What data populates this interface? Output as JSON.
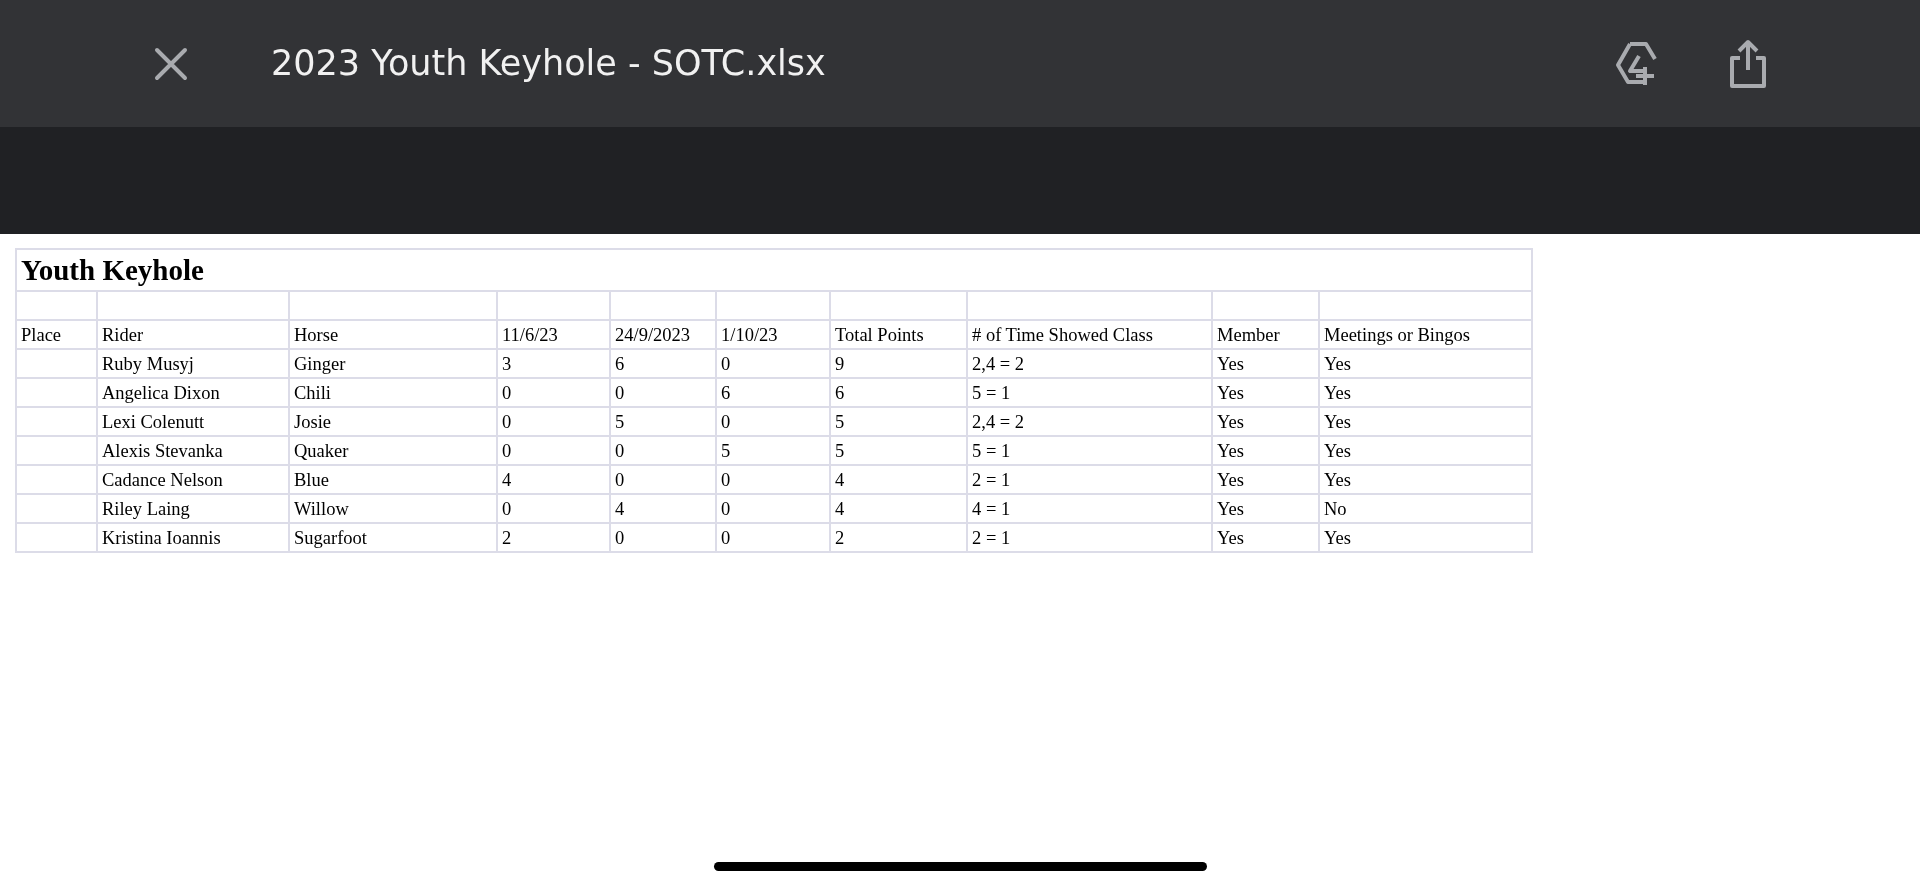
{
  "window": {
    "title": "2023 Youth Keyhole - SOTC.xlsx"
  },
  "sheet": {
    "title": "Youth Keyhole",
    "columns": [
      "Place",
      "Rider",
      "Horse",
      "11/6/23",
      "24/9/2023",
      "1/10/23",
      "Total Points",
      "# of Time Showed Class",
      "Member",
      "Meetings or Bingos"
    ],
    "rows": [
      {
        "cells": [
          "",
          "Ruby Musyj",
          "Ginger",
          "3",
          "6",
          "0",
          "9",
          "2,4 = 2",
          "Yes",
          "Yes"
        ]
      },
      {
        "cells": [
          "",
          "Angelica Dixon",
          "Chili",
          "0",
          "0",
          "6",
          "6",
          "5 = 1",
          "Yes",
          "Yes"
        ]
      },
      {
        "cells": [
          "",
          "Lexi Colenutt",
          "Josie",
          "0",
          "5",
          "0",
          "5",
          "2,4 = 2",
          "Yes",
          "Yes"
        ]
      },
      {
        "cells": [
          "",
          "Alexis Stevanka",
          "Quaker",
          "0",
          "0",
          "5",
          "5",
          "5 = 1",
          "Yes",
          "Yes"
        ]
      },
      {
        "cells": [
          "",
          "Cadance Nelson",
          "Blue",
          "4",
          "0",
          "0",
          "4",
          "2 = 1",
          "Yes",
          "Yes"
        ]
      },
      {
        "cells": [
          "",
          "Riley Laing",
          "Willow",
          "0",
          "4",
          "0",
          "4",
          "4 = 1",
          "Yes",
          "No"
        ]
      },
      {
        "cells": [
          "",
          "Kristina Ioannis",
          "Sugarfoot",
          "2",
          "0",
          "0",
          "2",
          "2 = 1",
          "Yes",
          "Yes"
        ]
      }
    ]
  }
}
